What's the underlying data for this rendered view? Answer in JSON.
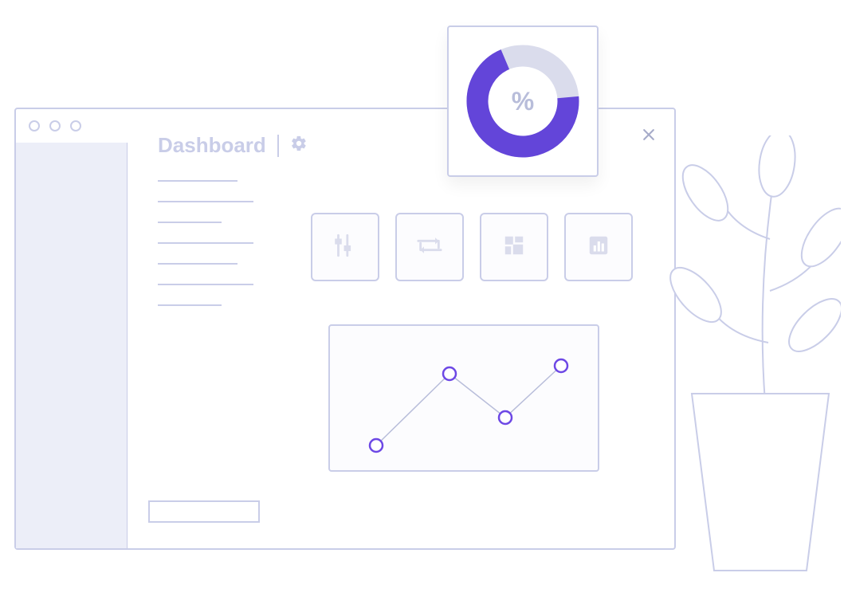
{
  "header": {
    "title": "Dashboard"
  },
  "donut": {
    "label": "%",
    "fill_percent": 70
  },
  "chart_data": {
    "type": "line",
    "x": [
      1,
      2,
      3,
      4
    ],
    "values": [
      20,
      70,
      40,
      80
    ]
  },
  "tiles": [
    {
      "name": "sliders"
    },
    {
      "name": "repeat"
    },
    {
      "name": "grid"
    },
    {
      "name": "bar-chart"
    }
  ]
}
